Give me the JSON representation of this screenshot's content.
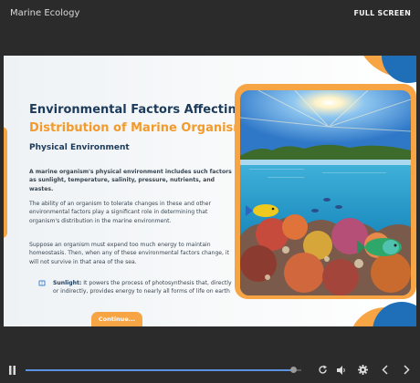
{
  "app": {
    "title": "Marine Ecology",
    "fullscreen_label": "FULL SCREEN"
  },
  "slide": {
    "title_line1": "Environmental Factors Affecting",
    "title_line2": "Distribution of Marine Organisms",
    "section_heading": "Physical Environment",
    "para1": "A marine organism's physical environment includes such factors as sunlight, temperature, salinity, pressure, nutrients, and wastes.",
    "para2": "The ability of an organism to tolerate changes in these and other environmental factors play a significant role in determining that organism's distribution in the marine environment.",
    "para3": "Suppose an organism must expend too much energy to maintain homeostasis. Then, when any of these environmental factors change, it will not survive in that area of the sea.",
    "bullet_term": "Sunlight:",
    "bullet_text": " It powers the process of photosynthesis that, directly or indirectly, provides energy to nearly all forms of life on earth",
    "continue_label": "Continue...",
    "image_description": "underwater coral reef with tropical fish under a sunny sky",
    "accent_color": "#f7a544",
    "primary_color": "#1c3a5a"
  },
  "player": {
    "progress_fraction": 0.97,
    "icons": [
      "pause-icon",
      "replay-icon",
      "volume-icon",
      "settings-icon",
      "previous-icon",
      "next-icon"
    ],
    "progress_color": "#5b93e0"
  }
}
